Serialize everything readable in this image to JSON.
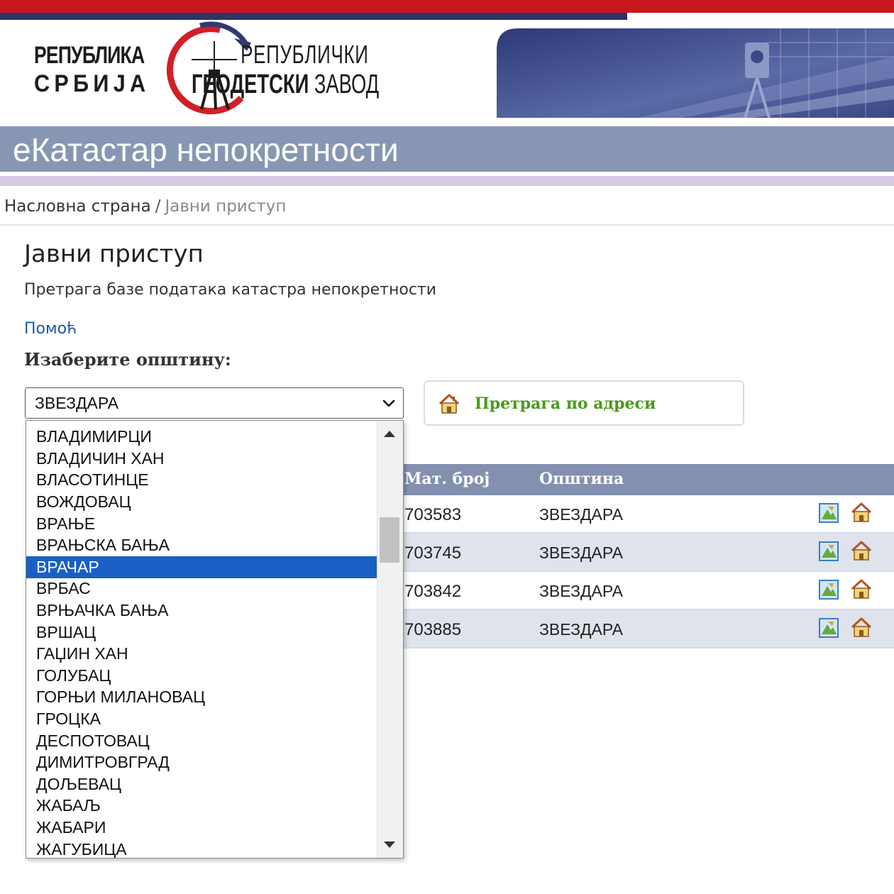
{
  "header": {
    "country_line1": "РЕПУБЛИКА",
    "country_line2": "СРБИЈА",
    "agency_line1": "РЕПУБЛИЧКИ",
    "agency_line2_bold": "ГЕОДЕТСКИ",
    "agency_line2_rest": "ЗАВОД",
    "app_title": "еКатастар непокретности"
  },
  "breadcrumb": {
    "home": "Насловна страна",
    "separator": "/",
    "current": "Јавни приступ"
  },
  "page": {
    "title": "Јавни приступ",
    "subtitle": "Претрага базе података катастра непокретности",
    "help_link": "Помоћ",
    "select_label": "Изаберите општину:"
  },
  "municipality_select": {
    "value": "ЗВЕЗДАРА",
    "options": [
      "ВЛАДИМИРЦИ",
      "ВЛАДИЧИН ХАН",
      "ВЛАСОТИНЦЕ",
      "ВОЖДОВАЦ",
      "ВРАЊЕ",
      "ВРАЊСКА БАЊА",
      "ВРАЧАР",
      "ВРБАС",
      "ВРЊАЧКА БАЊА",
      "ВРШАЦ",
      "ГАЏИН ХАН",
      "ГОЛУБАЦ",
      "ГОРЊИ МИЛАНОВАЦ",
      "ГРОЦКА",
      "ДЕСПОТОВАЦ",
      "ДИМИТРОВГРАД",
      "ДОЉЕВАЦ",
      "ЖАБАЉ",
      "ЖАБАРИ",
      "ЖАГУБИЦА"
    ],
    "highlighted": "ВРАЧАР"
  },
  "address_search_button": {
    "label": "Претрага по адреси",
    "icon": "house-icon"
  },
  "table": {
    "columns": [
      "Мат. број",
      "Општина"
    ],
    "rows": [
      {
        "mat_broj": "703583",
        "opstina": "ЗВЕЗДАРА"
      },
      {
        "mat_broj": "703745",
        "opstina": "ЗВЕЗДАРА"
      },
      {
        "mat_broj": "703842",
        "opstina": "ЗВЕЗДАРА"
      },
      {
        "mat_broj": "703885",
        "opstina": "ЗВЕЗДАРА"
      }
    ],
    "row_icons": [
      "map-icon",
      "house-icon"
    ]
  },
  "colors": {
    "brand_red": "#c8161d",
    "brand_navy": "#2b3566",
    "title_bar": "#8797b3",
    "table_header": "#8390b0",
    "link_blue": "#1b5c9c",
    "address_green": "#4a9a1a",
    "selected_option": "#1a5fc4"
  }
}
